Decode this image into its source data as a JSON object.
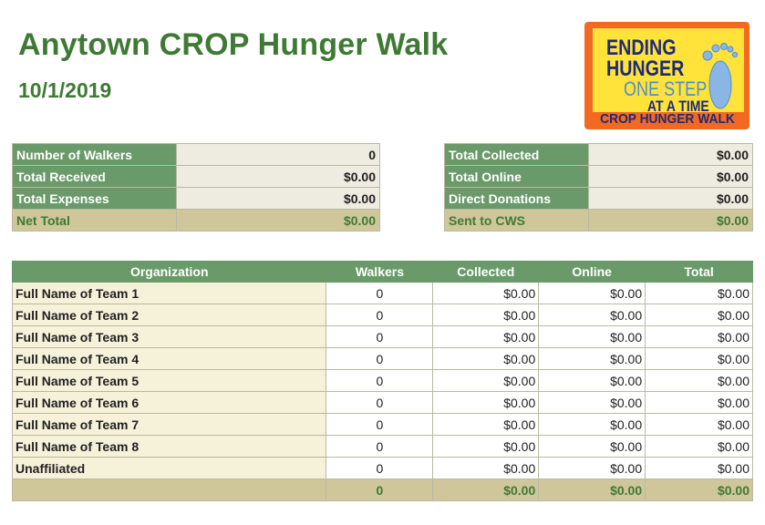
{
  "header": {
    "title": "Anytown CROP Hunger Walk",
    "date": "10/1/2019"
  },
  "logo": {
    "line1": "ENDING",
    "line2": "HUNGER",
    "line3": "ONE STEP",
    "line4": "AT A TIME",
    "footer": "CROP HUNGER WALK",
    "icon": "footprint-icon"
  },
  "summary_left": {
    "rows": [
      {
        "label": "Number of Walkers",
        "value": "0"
      },
      {
        "label": "Total Received",
        "value": "$0.00"
      },
      {
        "label": "Total Expenses",
        "value": "$0.00"
      }
    ],
    "total": {
      "label": "Net Total",
      "value": "$0.00"
    }
  },
  "summary_right": {
    "rows": [
      {
        "label": "Total Collected",
        "value": "$0.00"
      },
      {
        "label": "Total Online",
        "value": "$0.00"
      },
      {
        "label": "Direct Donations",
        "value": "$0.00"
      }
    ],
    "total": {
      "label": "Sent to CWS",
      "value": "$0.00"
    }
  },
  "teams_table": {
    "headers": [
      "Organization",
      "Walkers",
      "Collected",
      "Online",
      "Total"
    ],
    "rows": [
      {
        "org": "Full Name of Team 1",
        "walkers": "0",
        "collected": "$0.00",
        "online": "$0.00",
        "total": "$0.00"
      },
      {
        "org": "Full Name of Team 2",
        "walkers": "0",
        "collected": "$0.00",
        "online": "$0.00",
        "total": "$0.00"
      },
      {
        "org": "Full Name of Team 3",
        "walkers": "0",
        "collected": "$0.00",
        "online": "$0.00",
        "total": "$0.00"
      },
      {
        "org": "Full Name of Team 4",
        "walkers": "0",
        "collected": "$0.00",
        "online": "$0.00",
        "total": "$0.00"
      },
      {
        "org": "Full Name of Team 5",
        "walkers": "0",
        "collected": "$0.00",
        "online": "$0.00",
        "total": "$0.00"
      },
      {
        "org": "Full Name of Team 6",
        "walkers": "0",
        "collected": "$0.00",
        "online": "$0.00",
        "total": "$0.00"
      },
      {
        "org": "Full Name of Team 7",
        "walkers": "0",
        "collected": "$0.00",
        "online": "$0.00",
        "total": "$0.00"
      },
      {
        "org": "Full Name of Team 8",
        "walkers": "0",
        "collected": "$0.00",
        "online": "$0.00",
        "total": "$0.00"
      },
      {
        "org": "Unaffiliated",
        "walkers": "0",
        "collected": "$0.00",
        "online": "$0.00",
        "total": "$0.00"
      }
    ],
    "totals": {
      "org": "",
      "walkers": "0",
      "collected": "$0.00",
      "online": "$0.00",
      "total": "$0.00"
    }
  },
  "colors": {
    "title_green": "#3f7a35",
    "header_green": "#6a9a6a",
    "label_cream": "#f6f1d9",
    "value_cream": "#eeece0",
    "total_tan": "#cfc69a",
    "logo_orange": "#f26a21",
    "logo_yellow": "#ffe23a",
    "logo_navy": "#1e2a7a"
  }
}
